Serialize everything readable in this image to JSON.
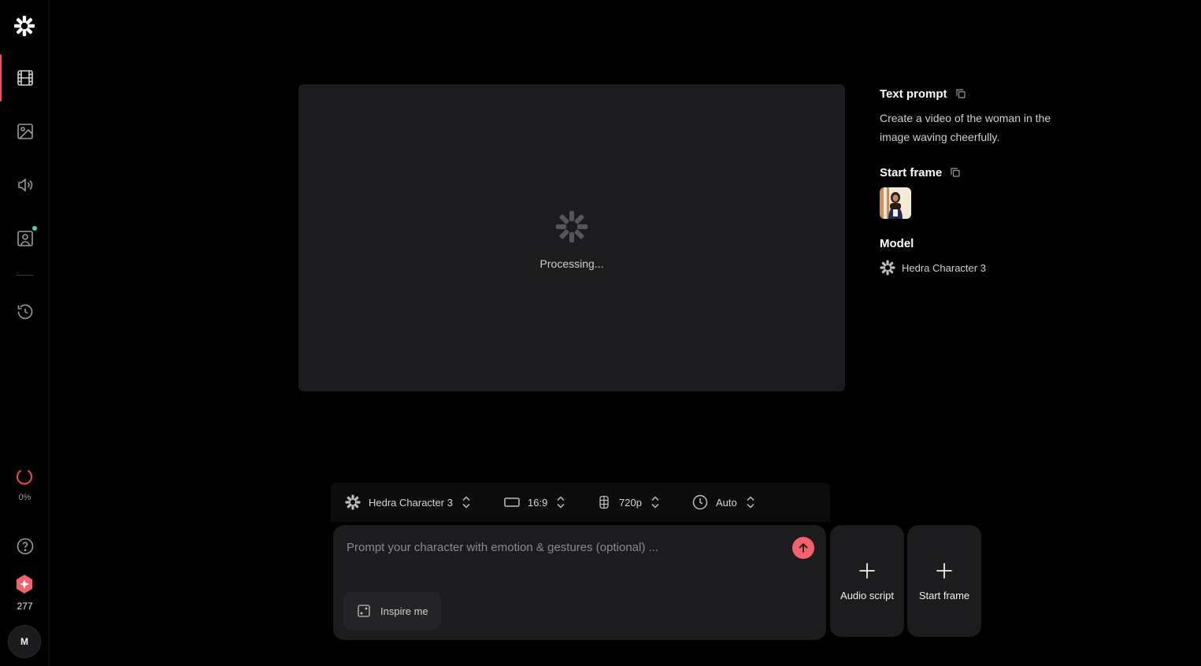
{
  "sidebar": {
    "logo_icon": "hedra-logo-icon",
    "nav": [
      {
        "name": "video",
        "icon": "film-icon",
        "active": true
      },
      {
        "name": "image",
        "icon": "image-icon",
        "active": false
      },
      {
        "name": "audio",
        "icon": "speaker-icon",
        "active": false
      },
      {
        "name": "characters",
        "icon": "portrait-icon",
        "active": false
      },
      {
        "name": "history",
        "icon": "history-icon",
        "active": false
      }
    ],
    "progress_label": "0%",
    "credits": "277",
    "avatar_initial": "M"
  },
  "preview": {
    "status": "Processing..."
  },
  "info": {
    "text_prompt_heading": "Text prompt",
    "text_prompt": "Create a video of the woman in the image waving cheerfully.",
    "start_frame_heading": "Start frame",
    "model_heading": "Model",
    "model_name": "Hedra Character 3"
  },
  "toolbar": {
    "model": "Hedra Character 3",
    "aspect_ratio": "16:9",
    "resolution": "720p",
    "duration": "Auto"
  },
  "composer": {
    "placeholder": "Prompt your character with emotion & gestures (optional) ...",
    "value": "",
    "inspire_label": "Inspire me"
  },
  "cards": {
    "audio_script": "Audio script",
    "start_frame": "Start frame"
  },
  "colors": {
    "accent": "#f0636b",
    "active_indicator": "#e8505b",
    "notification": "#3ddc97",
    "panel": "#1c1c1e"
  }
}
